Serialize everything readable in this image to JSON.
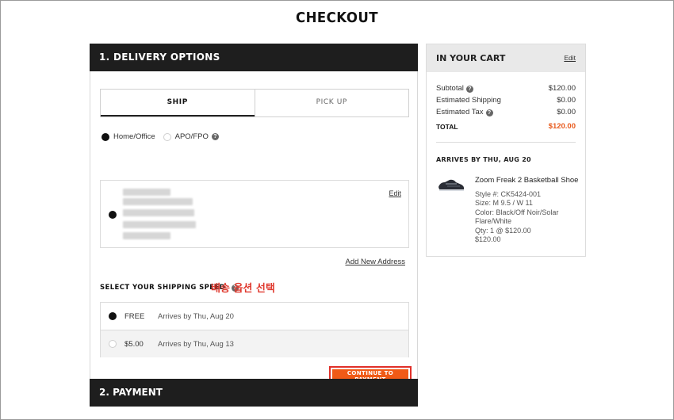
{
  "page_title": "CHECKOUT",
  "delivery": {
    "header": "1. DELIVERY OPTIONS",
    "tabs": [
      {
        "label": "SHIP"
      },
      {
        "label": "PICK UP"
      }
    ],
    "address_types": [
      {
        "label": "Home/Office"
      },
      {
        "label": "APO/FPO"
      }
    ],
    "edit_label": "Edit",
    "add_address_label": "Add New Address",
    "speed_label": "SELECT YOUR SHIPPING SPEED",
    "annotation": "배송 옵션 선택",
    "speeds": [
      {
        "price": "FREE",
        "arrival": "Arrives by Thu, Aug 20"
      },
      {
        "price": "$5.00",
        "arrival": "Arrives by Thu, Aug 13"
      }
    ],
    "continue_label": "CONTINUE TO PAYMENT"
  },
  "payment": {
    "header": "2. PAYMENT"
  },
  "cart": {
    "title": "IN YOUR CART",
    "edit_label": "Edit",
    "subtotal_label": "Subtotal",
    "subtotal": "$120.00",
    "shipping_label": "Estimated Shipping",
    "shipping": "$0.00",
    "tax_label": "Estimated Tax",
    "tax": "$0.00",
    "total_label": "TOTAL",
    "total": "$120.00",
    "arrives_label": "ARRIVES BY THU, AUG 20",
    "product": {
      "name": "Zoom Freak 2 Basketball Shoe",
      "style": "Style #: CK5424-001",
      "size": "Size: M 9.5 / W 11",
      "color": "Color: Black/Off Noir/Solar Flare/White",
      "qty": "Qty: 1 @ $120.00",
      "price": "$120.00"
    }
  },
  "colors": {
    "accent": "#f05a16",
    "header_bg": "#1e1e1e",
    "total": "#e85b1e",
    "annotation": "#e03a2f"
  }
}
